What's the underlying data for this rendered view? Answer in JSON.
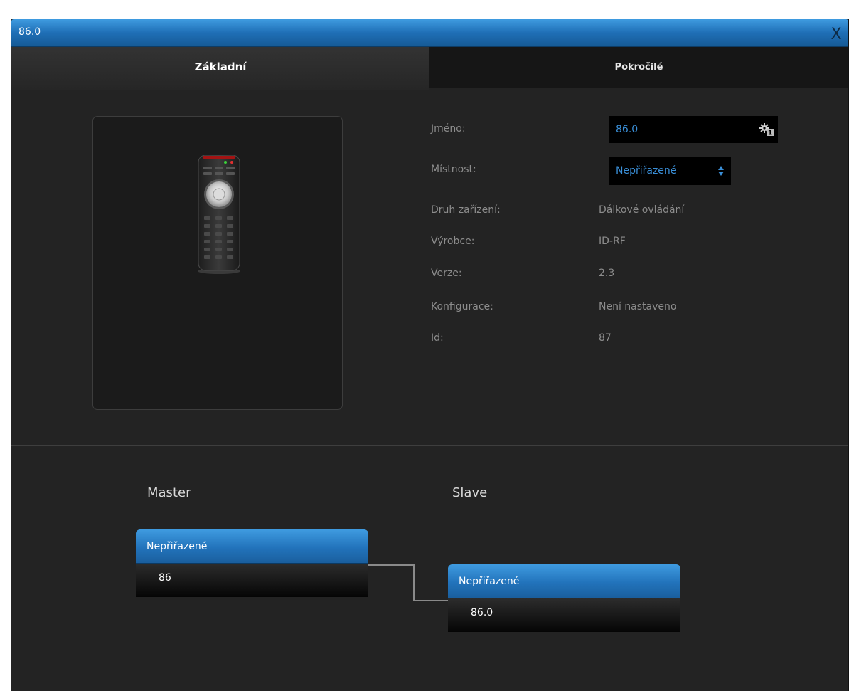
{
  "window": {
    "title": "86.0",
    "close_label": "X"
  },
  "tabs": [
    {
      "label": "Základní",
      "active": true
    },
    {
      "label": "Pokročilé",
      "active": false
    }
  ],
  "device": {
    "image_icon": "remote-control-icon",
    "fields": {
      "name": {
        "label": "Jméno:",
        "value": "86.0",
        "badge_icon": "gear-badge-icon",
        "badge_count": "1"
      },
      "room": {
        "label": "Místnost:",
        "value": "Nepřiřazené",
        "arrows_icon": "select-arrows-icon"
      },
      "type": {
        "label": "Druh zařízení:",
        "value": "Dálkové ovládání"
      },
      "manufacturer": {
        "label": "Výrobce:",
        "value": "ID-RF"
      },
      "version": {
        "label": "Verze:",
        "value": "2.3"
      },
      "configuration": {
        "label": "Konfigurace:",
        "value": "Není nastaveno"
      },
      "id": {
        "label": "Id:",
        "value": "87"
      }
    }
  },
  "association": {
    "master": {
      "heading": "Master",
      "room": "Nepřiřazené",
      "device": "86"
    },
    "slave": {
      "heading": "Slave",
      "room": "Nepřiřazené",
      "device": "86.0"
    }
  },
  "colors": {
    "accent_blue": "#1f6fb6",
    "value_blue": "#3a8fd8",
    "panel_bg": "#232323"
  }
}
